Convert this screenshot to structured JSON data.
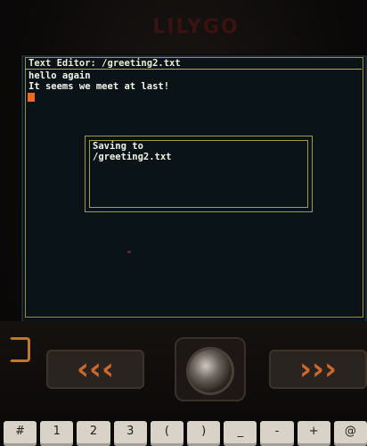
{
  "device": {
    "brand": "LILYGO"
  },
  "editor": {
    "title": "Text Editor: /greeting2.txt",
    "lines": [
      "hello again",
      "It seems we meet at last!"
    ]
  },
  "dialog": {
    "line1": "Saving to",
    "line2": "/greeting2.txt"
  },
  "keyboard": {
    "keys": [
      "#",
      "1",
      "2",
      "3",
      "(",
      ")",
      "_",
      "-",
      "+",
      "@"
    ]
  },
  "colors": {
    "screen_bg": "#0a1418",
    "frame": "#9a8f3c",
    "text": "#f2f5ec",
    "cursor": "#f06a1a",
    "accent_arrows": "#d0682a"
  },
  "icons": {
    "left_pad": "chevron-left-icon",
    "right_pad": "chevron-right-icon",
    "trackball": "trackball-icon"
  }
}
